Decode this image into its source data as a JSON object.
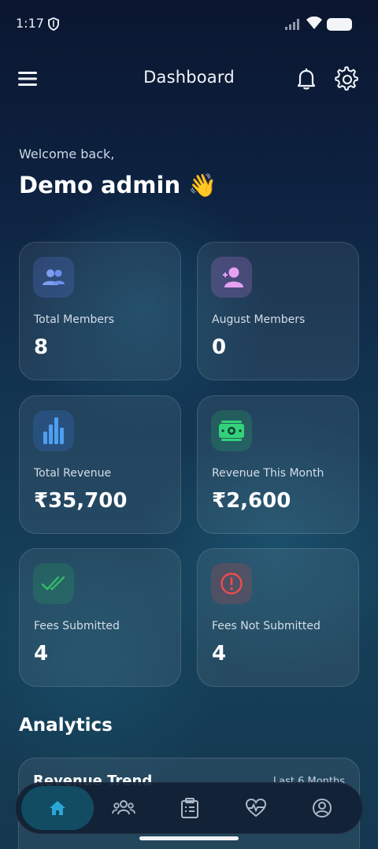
{
  "status_bar": {
    "time": "1:17"
  },
  "app_bar": {
    "title": "Dashboard"
  },
  "greeting": {
    "welcome": "Welcome back,",
    "name": "Demo admin 👋"
  },
  "stats": [
    {
      "label": "Total Members",
      "value": "8",
      "icon": "users-icon",
      "color": "#6b8ff0"
    },
    {
      "label": "August Members",
      "value": "0",
      "icon": "add-user-icon",
      "color": "#e8a0f5"
    },
    {
      "label": "Total Revenue",
      "value": "₹35,700",
      "icon": "bar-chart-icon",
      "color": "#4d9ff2"
    },
    {
      "label": "Revenue This Month",
      "value": "₹2,600",
      "icon": "cash-icon",
      "color": "#33d17a"
    },
    {
      "label": "Fees Submitted",
      "value": "4",
      "icon": "double-check-icon",
      "color": "#31b96a"
    },
    {
      "label": "Fees Not Submitted",
      "value": "4",
      "icon": "alert-circle-icon",
      "color": "#ef4b4b"
    }
  ],
  "analytics": {
    "section_title": "Analytics",
    "card_title": "Revenue Trend",
    "range_label": "Last 6 Months"
  },
  "bottom_nav": [
    {
      "name": "home",
      "icon": "home-icon",
      "active": true
    },
    {
      "name": "members",
      "icon": "group-icon",
      "active": false
    },
    {
      "name": "plans",
      "icon": "clipboard-icon",
      "active": false
    },
    {
      "name": "health",
      "icon": "heart-pulse-icon",
      "active": false
    },
    {
      "name": "profile",
      "icon": "profile-icon",
      "active": false
    }
  ]
}
